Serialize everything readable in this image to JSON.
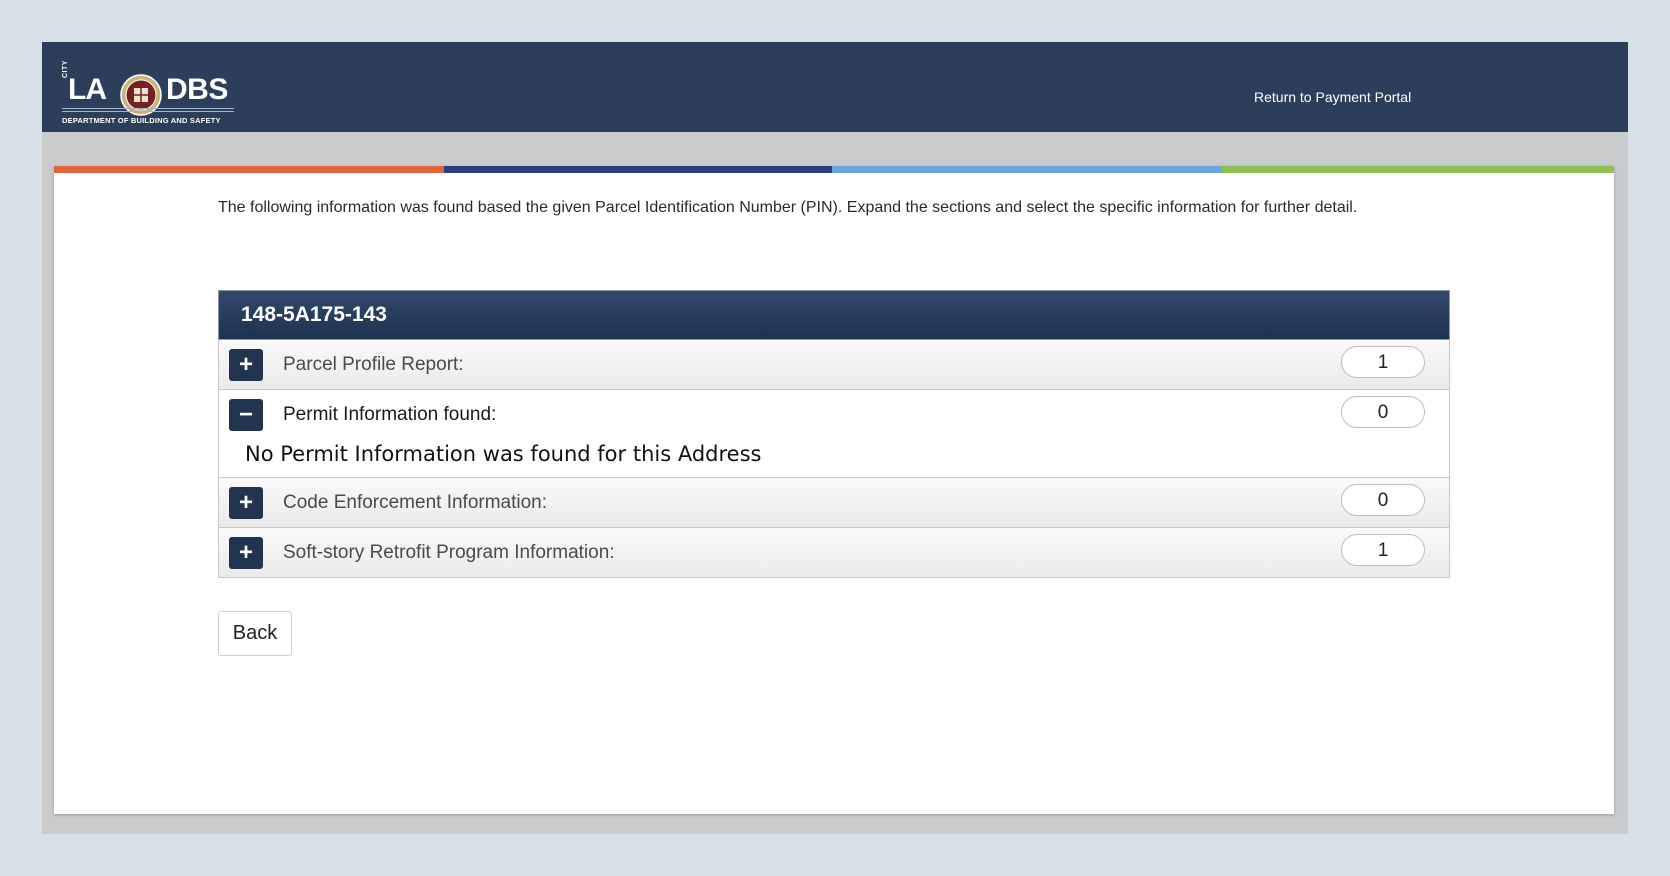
{
  "header": {
    "logo": {
      "city": "CITY",
      "la": "LA",
      "dbs": "DBS",
      "department": "DEPARTMENT OF BUILDING AND SAFETY"
    },
    "portal_link": "Return to Payment Portal"
  },
  "stripe_colors": [
    "#e0663a",
    "#2d3f7a",
    "#6aa6e0",
    "#8cc152"
  ],
  "intro_text": "The following information was found based the given Parcel Identification Number (PIN). Expand the sections and select the specific information for further detail.",
  "panel": {
    "pin": "148-5A175-143",
    "rows": [
      {
        "toggle": "+",
        "label": "Parcel Profile Report:",
        "count": "1"
      },
      {
        "toggle": "−",
        "label": "Permit Information found:",
        "count": "0",
        "detail": "No Permit Information was found for this Address"
      },
      {
        "toggle": "+",
        "label": "Code Enforcement Information:",
        "count": "0"
      },
      {
        "toggle": "+",
        "label": "Soft-story Retrofit Program Information:",
        "count": "1"
      }
    ]
  },
  "back_label": "Back"
}
